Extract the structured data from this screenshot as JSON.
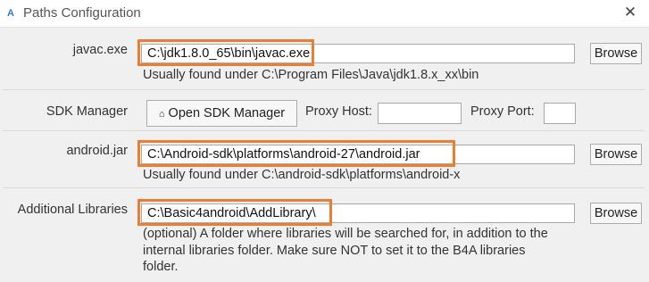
{
  "window": {
    "icon_letter": "A",
    "title": "Paths Configuration",
    "close_glyph": "✕"
  },
  "javac": {
    "label": "javac.exe",
    "value": "C:\\jdk1.8.0_65\\bin\\javac.exe",
    "browse": "Browse",
    "hint": "Usually found under C:\\Program Files\\Java\\jdk1.8.x_xx\\bin"
  },
  "sdk": {
    "label": "SDK Manager",
    "button_icon": "⌂",
    "button": "Open SDK Manager",
    "proxy_host_label": "Proxy Host:",
    "proxy_host_value": "",
    "proxy_port_label": "Proxy Port:",
    "proxy_port_value": ""
  },
  "android": {
    "label": "android.jar",
    "value": "C:\\Android-sdk\\platforms\\android-27\\android.jar",
    "browse": "Browse",
    "hint": "Usually found under C:\\android-sdk\\platforms\\android-x"
  },
  "libraries": {
    "label": "Additional Libraries",
    "value": "C:\\Basic4android\\AddLibrary\\",
    "browse": "Browse",
    "hint_line1": "(optional) A folder where libraries will be searched for, in addition to the",
    "hint_line2": "internal libraries folder. Make sure NOT to set it to the B4A libraries",
    "hint_line3": "folder."
  },
  "colors": {
    "highlight": "#ed7d31",
    "accent": "#2b7bd8"
  }
}
